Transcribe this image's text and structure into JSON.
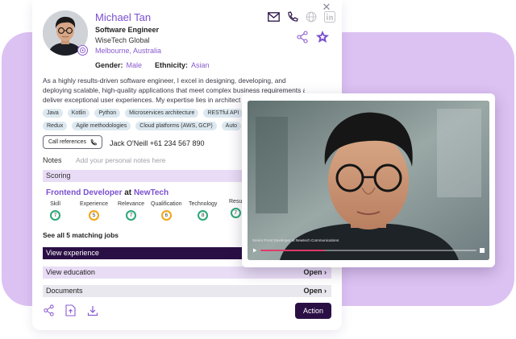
{
  "profile": {
    "name": "Michael Tan",
    "title": "Software Engineer",
    "company": "WiseTech Global",
    "location": "Melbourne, Australia",
    "gender_label": "Gender:",
    "gender": "Male",
    "ethnicity_label": "Ethnicity:",
    "ethnicity": "Asian",
    "bio_lines": [
      "As a highly results-driven software engineer, I excel in designing, developing, and",
      "deploying scalable, high-quality applications that meet complex business requirements and",
      "deliver exceptional user experiences. My expertise lies in architect"
    ]
  },
  "skills_row1": [
    "Java",
    "Kotlin",
    "Python",
    "Microservices architecture",
    "RESTful API"
  ],
  "skills_row2": [
    "Redux",
    "Agile methodologies",
    "Cloud platforms (AWS, GCP)",
    "Auto"
  ],
  "call": {
    "button_label": "Call references",
    "contact": "Jack O'Neill  +61 234 567 890"
  },
  "notes": {
    "label": "Notes",
    "placeholder": "Add your personal notes here"
  },
  "scoring": {
    "header": "Scoring",
    "job_role": "Frontend Developer",
    "at": "at",
    "job_company": "NewTech",
    "metrics": [
      {
        "label": "Skill",
        "score": "7",
        "color": "#2aa876"
      },
      {
        "label": "Experience",
        "score": "5",
        "color": "#f2a516"
      },
      {
        "label": "Relevance",
        "score": "7",
        "color": "#2aa876"
      },
      {
        "label": "Qualification",
        "score": "6",
        "color": "#f2a516"
      },
      {
        "label": "Technology",
        "score": "8",
        "color": "#2aa876"
      },
      {
        "label": "Resu",
        "score": "7",
        "color": "#2aa876"
      }
    ],
    "see_all": "See all 5 matching jobs"
  },
  "sections": {
    "experience": "View experience",
    "education": "View education",
    "documents": "Documents",
    "open_label": "Open"
  },
  "action_label": "Action",
  "video": {
    "caption": "Senior Front Developer at Newtech Communications",
    "progress": 0.3
  },
  "colors": {
    "accent": "#7a4fd0",
    "dark": "#2a0f45",
    "background_blob": "#dcc2f3"
  }
}
